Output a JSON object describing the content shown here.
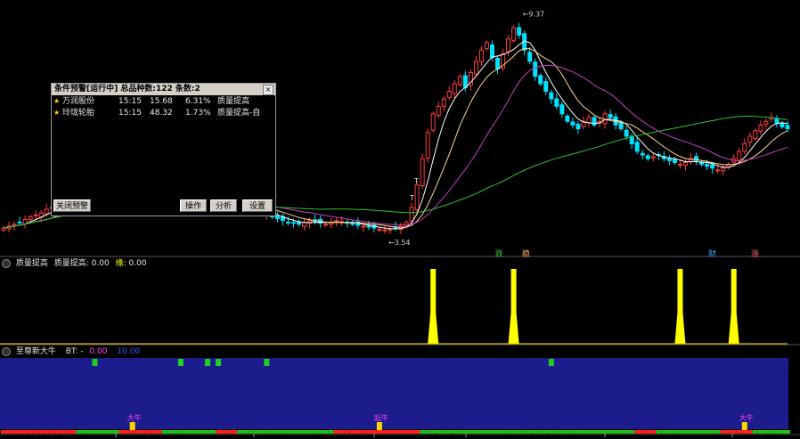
{
  "colors": {
    "up": "#ff3c3c",
    "down": "#00e0ff",
    "ma5": "#ffffff",
    "ma10": "#ffd88a",
    "ma20": "#c040c0",
    "ma60": "#30c030",
    "signal": "#ffff00",
    "panel3_bg": "#1c1c8c"
  },
  "main_chart": {
    "peak_label": "9.37",
    "low_label": "3.54",
    "t_markers": [
      "T",
      "T"
    ],
    "bottom_labels": [
      {
        "text": "跌",
        "color": "#40c040"
      },
      {
        "text": "稳",
        "color": "#ffb060"
      },
      {
        "text": "财",
        "color": "#40a0ff"
      },
      {
        "text": "涨",
        "color": "#ff6060"
      }
    ]
  },
  "panel2": {
    "label": "质量提高",
    "field1_label": "质量提高:",
    "field1_value": "0.00",
    "field2_label": "缘:",
    "field2_value": "0.00"
  },
  "panel3": {
    "label": "至尊新大牛",
    "field1_label": "BT: -",
    "field1_value": "0.00",
    "field2_value": "10.00",
    "big_bull_label": "大牛",
    "start_label": "起牛"
  },
  "alert": {
    "title": "条件预警[运行中] 总品种数:122 条数:2",
    "close_icon": "×",
    "rows": [
      {
        "name": "万润股份",
        "time": "15:15",
        "price": "15.68",
        "pct": "6.31%",
        "cond": "质量提高"
      },
      {
        "name": "玲珑轮胎",
        "time": "15:15",
        "price": "48.32",
        "pct": "1.73%",
        "cond": "质量提高-自"
      }
    ],
    "buttons": {
      "close_alert": "关闭预警",
      "operate": "操作",
      "analyze": "分析",
      "settings": "设置"
    }
  },
  "chart_data": {
    "type": "candlestick",
    "x": [
      0,
      1,
      2,
      3,
      4,
      5,
      6,
      7,
      8,
      9,
      10,
      11,
      12,
      13,
      14,
      15,
      16,
      17,
      18,
      19,
      20,
      21,
      22,
      23,
      24,
      25,
      26,
      27,
      28,
      29,
      30,
      31,
      32,
      33,
      34,
      35,
      36,
      37,
      38,
      39,
      40,
      41,
      42,
      43,
      44,
      45,
      46,
      47,
      48,
      49,
      50,
      51,
      52,
      53,
      54,
      55,
      56,
      57,
      58,
      59,
      60,
      61,
      62,
      63,
      64,
      65,
      66,
      67,
      68,
      69,
      70,
      71,
      72,
      73,
      74,
      75,
      76,
      77,
      78,
      79,
      80,
      81,
      82,
      83,
      84,
      85,
      86,
      87,
      88,
      89,
      90,
      91,
      92,
      93,
      94,
      95,
      96,
      97,
      98,
      99,
      100,
      101,
      102,
      103,
      104,
      105,
      106,
      107,
      108,
      109,
      110,
      111,
      112,
      113,
      114,
      115,
      116,
      117,
      118,
      119,
      120,
      121,
      122,
      123,
      124,
      125,
      126,
      127,
      128,
      129,
      130,
      131,
      132,
      133,
      134,
      135,
      136,
      137,
      138,
      139,
      140,
      141,
      142,
      143,
      144,
      145,
      146
    ],
    "close": [
      3.75,
      3.8,
      3.85,
      3.9,
      3.98,
      4.05,
      4.1,
      4.15,
      4.25,
      4.3,
      4.35,
      4.38,
      4.4,
      4.42,
      4.38,
      4.4,
      4.45,
      4.42,
      4.46,
      4.48,
      4.5,
      4.46,
      4.42,
      4.45,
      4.48,
      4.5,
      4.46,
      4.42,
      4.45,
      4.48,
      4.44,
      4.4,
      4.42,
      4.45,
      4.42,
      4.38,
      4.35,
      4.38,
      4.42,
      4.4,
      4.38,
      4.36,
      4.4,
      4.38,
      4.35,
      4.3,
      4.25,
      4.2,
      4.15,
      4.1,
      4.05,
      4.0,
      3.95,
      3.9,
      3.88,
      3.85,
      3.9,
      3.95,
      3.92,
      3.88,
      3.85,
      3.9,
      3.95,
      3.92,
      3.88,
      3.85,
      3.82,
      3.8,
      3.78,
      3.75,
      3.72,
      3.7,
      3.72,
      3.75,
      3.8,
      3.9,
      4.3,
      4.9,
      5.6,
      6.3,
      6.8,
      7.0,
      7.2,
      7.4,
      7.6,
      7.8,
      7.5,
      7.9,
      8.2,
      8.5,
      8.7,
      8.3,
      8.0,
      8.4,
      8.8,
      9.1,
      8.9,
      8.5,
      8.2,
      7.8,
      7.6,
      7.4,
      7.2,
      7.0,
      6.8,
      6.6,
      6.5,
      6.4,
      6.6,
      6.7,
      6.5,
      6.6,
      6.8,
      6.7,
      6.5,
      6.4,
      6.2,
      6.0,
      5.8,
      5.7,
      5.6,
      5.65,
      5.7,
      5.6,
      5.55,
      5.5,
      5.45,
      5.5,
      5.6,
      5.55,
      5.45,
      5.4,
      5.35,
      5.3,
      5.35,
      5.45,
      5.6,
      5.8,
      6.0,
      6.2,
      6.35,
      6.5,
      6.6,
      6.7,
      6.55,
      6.45,
      6.4
    ],
    "markers": [
      {
        "label": "9.37",
        "x": 96,
        "y": 9.37
      },
      {
        "label": "3.54",
        "x": 71,
        "y": 3.54
      }
    ],
    "moving_averages": [
      "MA5",
      "MA10",
      "MA20",
      "MA60"
    ],
    "panel2_signal_x": [
      80,
      95,
      126,
      136
    ],
    "panel2_signal_value": 1
  }
}
